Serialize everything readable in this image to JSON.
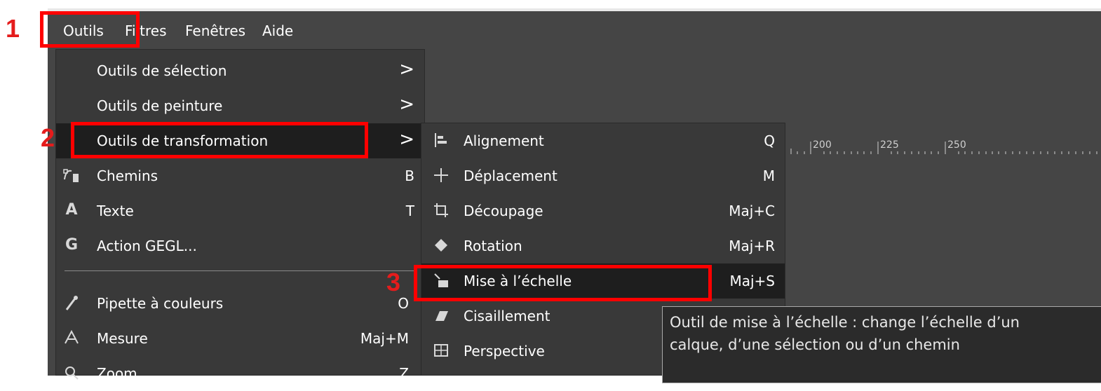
{
  "menubar": {
    "items": [
      "Outils",
      "Filtres",
      "Fenêtres",
      "Aide"
    ]
  },
  "tools_menu": {
    "items": [
      {
        "label": "Outils de sélection",
        "shortcut": "",
        "submenu": true,
        "icon": ""
      },
      {
        "label": "Outils de peinture",
        "shortcut": "",
        "submenu": true,
        "icon": ""
      },
      {
        "label": "Outils de transformation",
        "shortcut": "",
        "submenu": true,
        "icon": ""
      },
      {
        "label": "Chemins",
        "shortcut": "B",
        "submenu": false,
        "icon": "paths-icon"
      },
      {
        "label": "Texte",
        "shortcut": "T",
        "submenu": false,
        "icon": "text-icon"
      },
      {
        "label": "Action GEGL...",
        "shortcut": "",
        "submenu": false,
        "icon": "gegl-icon"
      },
      {
        "label": "Pipette à couleurs",
        "shortcut": "O",
        "submenu": false,
        "icon": "color-picker-icon"
      },
      {
        "label": "Mesure",
        "shortcut": "Maj+M",
        "submenu": false,
        "icon": "measure-icon"
      },
      {
        "label": "Zoom",
        "shortcut": "Z",
        "submenu": false,
        "icon": "zoom-icon"
      }
    ],
    "arrow": ">"
  },
  "transform_menu": {
    "items": [
      {
        "label": "Alignement",
        "shortcut": "Q",
        "icon": "align-icon"
      },
      {
        "label": "Déplacement",
        "shortcut": "M",
        "icon": "move-icon"
      },
      {
        "label": "Découpage",
        "shortcut": "Maj+C",
        "icon": "crop-icon"
      },
      {
        "label": "Rotation",
        "shortcut": "Maj+R",
        "icon": "rotate-icon"
      },
      {
        "label": "Mise à l’échelle",
        "shortcut": "Maj+S",
        "icon": "scale-icon"
      },
      {
        "label": "Cisaillement",
        "shortcut": "",
        "icon": "shear-icon"
      },
      {
        "label": "Perspective",
        "shortcut": "",
        "icon": "perspective-icon"
      }
    ]
  },
  "ruler": {
    "labels": [
      "200",
      "225",
      "250"
    ]
  },
  "tooltip": {
    "line1": "Outil de mise à l’échelle : change l’échelle d’un",
    "line2": "calque, d’une sélection ou d’un chemin"
  },
  "annotations": {
    "step1": "1",
    "step2": "2",
    "step3": "3",
    "color": "#ff0000"
  }
}
